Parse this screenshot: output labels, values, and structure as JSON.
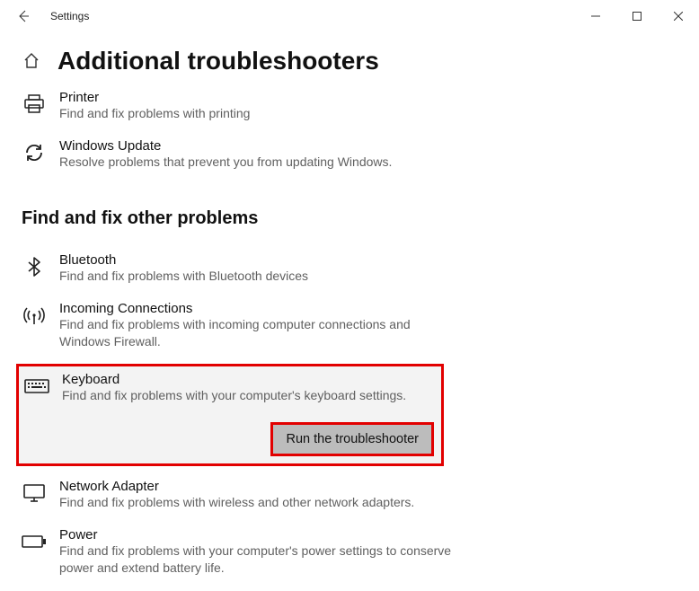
{
  "window": {
    "title": "Settings"
  },
  "page": {
    "title": "Additional troubleshooters"
  },
  "top_items": [
    {
      "title": "Printer",
      "desc": "Find and fix problems with printing"
    },
    {
      "title": "Windows Update",
      "desc": "Resolve problems that prevent you from updating Windows."
    }
  ],
  "section": {
    "title": "Find and fix other problems"
  },
  "items": [
    {
      "title": "Bluetooth",
      "desc": "Find and fix problems with Bluetooth devices"
    },
    {
      "title": "Incoming Connections",
      "desc": "Find and fix problems with incoming computer connections and Windows Firewall."
    },
    {
      "title": "Keyboard",
      "desc": "Find and fix problems with your computer's keyboard settings."
    },
    {
      "title": "Network Adapter",
      "desc": "Find and fix problems with wireless and other network adapters."
    },
    {
      "title": "Power",
      "desc": "Find and fix problems with your computer's power settings to conserve power and extend battery life."
    }
  ],
  "actions": {
    "run_troubleshooter": "Run the troubleshooter"
  }
}
